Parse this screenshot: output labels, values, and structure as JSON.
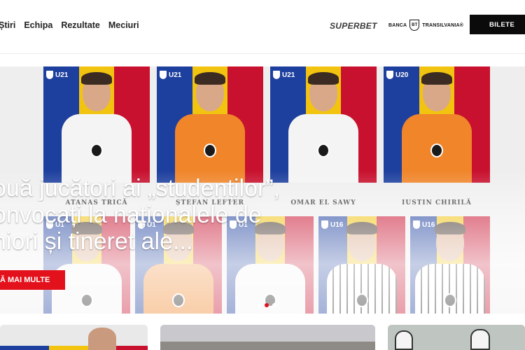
{
  "nav": {
    "items": [
      "Știri",
      "Echipa",
      "Rezultate",
      "Meciuri"
    ]
  },
  "sponsors": {
    "superbet": "SUPERBET",
    "bt_left": "BANCA",
    "bt_badge": "BT",
    "bt_right": "TRANSILVANIA®"
  },
  "header": {
    "tickets_label": "BILETE"
  },
  "hero": {
    "headline_lines": [
      "ouă jucători ai „studenților”,",
      "onvocați la naționalele de",
      "niori și tineret ale..."
    ],
    "more_label": "Ă MAI MULTE",
    "cards_top": [
      {
        "badge": "U21",
        "name": "ATANAS TRICĂ"
      },
      {
        "badge": "U21",
        "name": "ȘTEFAN LEFTER"
      },
      {
        "badge": "U21",
        "name": "OMAR EL SAWY"
      },
      {
        "badge": "U20",
        "name": "IUSTIN CHIRILĂ"
      }
    ],
    "cards_bottom": [
      {
        "badge": "U1"
      },
      {
        "badge": "U1"
      },
      {
        "badge": "U1"
      },
      {
        "badge": "U16"
      },
      {
        "badge": "U16"
      }
    ],
    "slide_count": 3,
    "active_slide": 2
  },
  "colors": {
    "accent_red": "#e3111b",
    "button_black": "#0b0b0b",
    "flag_blue": "#1d3f9e",
    "flag_yellow": "#f2c40f",
    "flag_red": "#c8112e"
  }
}
